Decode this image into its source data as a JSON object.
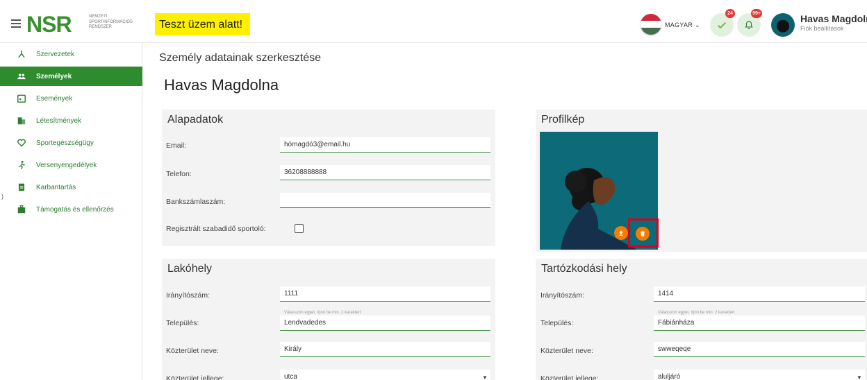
{
  "header": {
    "logo_text": "NSR",
    "logo_subtitle_1": "NEMZETI",
    "logo_subtitle_2": "SPORTINFORMÁCIÓS",
    "logo_subtitle_3": "RENDSZER",
    "test_banner": "Teszt üzem alatt!",
    "language": "MAGYAR",
    "tasks_badge": "24",
    "notifications_badge": "99+",
    "user_name": "Havas Magdolna",
    "user_sub": "Fiók beállítások"
  },
  "sidebar": {
    "items": [
      {
        "label": "Szervezetek",
        "icon": "organization-icon",
        "active": false
      },
      {
        "label": "Személyek",
        "icon": "people-icon",
        "active": true
      },
      {
        "label": "Események",
        "icon": "calendar-icon",
        "active": false
      },
      {
        "label": "Létesítmények",
        "icon": "building-icon",
        "active": false
      },
      {
        "label": "Sportegészségügy",
        "icon": "heart-icon",
        "active": false
      },
      {
        "label": "Versenyengedélyek",
        "icon": "runner-icon",
        "active": false
      },
      {
        "label": "Karbantartás",
        "icon": "clipboard-icon",
        "active": false
      },
      {
        "label": "Támogatás és ellenőrzés",
        "icon": "briefcase-icon",
        "active": false
      }
    ]
  },
  "main": {
    "page_title": "Személy adatainak szerkesztése",
    "person_name": "Havas Magdolna"
  },
  "basic": {
    "title": "Alapadatok",
    "email_label": "Email:",
    "email_value": "hómagdó3@email.hu",
    "phone_label": "Telefon:",
    "phone_value": "36208888888",
    "bank_label": "Bankszámlaszám:",
    "bank_value": "",
    "registered_label": "Regisztrált szabadidő sportoló:"
  },
  "profile": {
    "title": "Profilkép"
  },
  "residence": {
    "title": "Lakóhely",
    "zip_label": "Irányítószám:",
    "zip_value": "1111",
    "city_hint": "Válasszon egyet, írjon be min. 2 karaktert",
    "city_label": "Település:",
    "city_value": "Lendvadedes",
    "street_label": "Közterület neve:",
    "street_value": "Király",
    "street_type_label": "Közterület jellege:",
    "street_type_value": "utca"
  },
  "stay": {
    "title": "Tartózkodási hely",
    "zip_label": "Irányítószám:",
    "zip_value": "1414",
    "city_hint": "Válasszon egyet, írjon be min. 2 karaktert",
    "city_label": "Település:",
    "city_value": "Fábiánháza",
    "street_label": "Közterület neve:",
    "street_value": "swweqeqe",
    "street_type_label": "Közterület jellege:",
    "street_type_value": "aluljáró"
  }
}
